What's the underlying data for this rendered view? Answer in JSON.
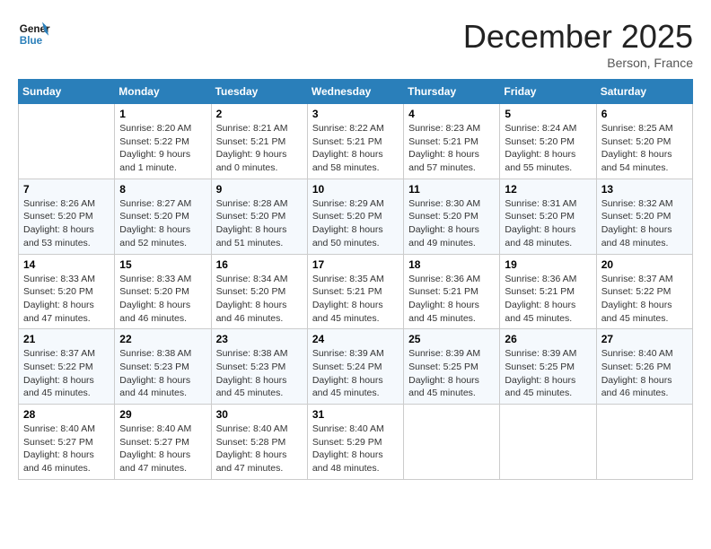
{
  "header": {
    "logo_line1": "General",
    "logo_line2": "Blue",
    "month_title": "December 2025",
    "location": "Berson, France"
  },
  "weekdays": [
    "Sunday",
    "Monday",
    "Tuesday",
    "Wednesday",
    "Thursday",
    "Friday",
    "Saturday"
  ],
  "weeks": [
    [
      {
        "day": "",
        "info": ""
      },
      {
        "day": "1",
        "info": "Sunrise: 8:20 AM\nSunset: 5:22 PM\nDaylight: 9 hours\nand 1 minute."
      },
      {
        "day": "2",
        "info": "Sunrise: 8:21 AM\nSunset: 5:21 PM\nDaylight: 9 hours\nand 0 minutes."
      },
      {
        "day": "3",
        "info": "Sunrise: 8:22 AM\nSunset: 5:21 PM\nDaylight: 8 hours\nand 58 minutes."
      },
      {
        "day": "4",
        "info": "Sunrise: 8:23 AM\nSunset: 5:21 PM\nDaylight: 8 hours\nand 57 minutes."
      },
      {
        "day": "5",
        "info": "Sunrise: 8:24 AM\nSunset: 5:20 PM\nDaylight: 8 hours\nand 55 minutes."
      },
      {
        "day": "6",
        "info": "Sunrise: 8:25 AM\nSunset: 5:20 PM\nDaylight: 8 hours\nand 54 minutes."
      }
    ],
    [
      {
        "day": "7",
        "info": "Sunrise: 8:26 AM\nSunset: 5:20 PM\nDaylight: 8 hours\nand 53 minutes."
      },
      {
        "day": "8",
        "info": "Sunrise: 8:27 AM\nSunset: 5:20 PM\nDaylight: 8 hours\nand 52 minutes."
      },
      {
        "day": "9",
        "info": "Sunrise: 8:28 AM\nSunset: 5:20 PM\nDaylight: 8 hours\nand 51 minutes."
      },
      {
        "day": "10",
        "info": "Sunrise: 8:29 AM\nSunset: 5:20 PM\nDaylight: 8 hours\nand 50 minutes."
      },
      {
        "day": "11",
        "info": "Sunrise: 8:30 AM\nSunset: 5:20 PM\nDaylight: 8 hours\nand 49 minutes."
      },
      {
        "day": "12",
        "info": "Sunrise: 8:31 AM\nSunset: 5:20 PM\nDaylight: 8 hours\nand 48 minutes."
      },
      {
        "day": "13",
        "info": "Sunrise: 8:32 AM\nSunset: 5:20 PM\nDaylight: 8 hours\nand 48 minutes."
      }
    ],
    [
      {
        "day": "14",
        "info": "Sunrise: 8:33 AM\nSunset: 5:20 PM\nDaylight: 8 hours\nand 47 minutes."
      },
      {
        "day": "15",
        "info": "Sunrise: 8:33 AM\nSunset: 5:20 PM\nDaylight: 8 hours\nand 46 minutes."
      },
      {
        "day": "16",
        "info": "Sunrise: 8:34 AM\nSunset: 5:20 PM\nDaylight: 8 hours\nand 46 minutes."
      },
      {
        "day": "17",
        "info": "Sunrise: 8:35 AM\nSunset: 5:21 PM\nDaylight: 8 hours\nand 45 minutes."
      },
      {
        "day": "18",
        "info": "Sunrise: 8:36 AM\nSunset: 5:21 PM\nDaylight: 8 hours\nand 45 minutes."
      },
      {
        "day": "19",
        "info": "Sunrise: 8:36 AM\nSunset: 5:21 PM\nDaylight: 8 hours\nand 45 minutes."
      },
      {
        "day": "20",
        "info": "Sunrise: 8:37 AM\nSunset: 5:22 PM\nDaylight: 8 hours\nand 45 minutes."
      }
    ],
    [
      {
        "day": "21",
        "info": "Sunrise: 8:37 AM\nSunset: 5:22 PM\nDaylight: 8 hours\nand 45 minutes."
      },
      {
        "day": "22",
        "info": "Sunrise: 8:38 AM\nSunset: 5:23 PM\nDaylight: 8 hours\nand 44 minutes."
      },
      {
        "day": "23",
        "info": "Sunrise: 8:38 AM\nSunset: 5:23 PM\nDaylight: 8 hours\nand 45 minutes."
      },
      {
        "day": "24",
        "info": "Sunrise: 8:39 AM\nSunset: 5:24 PM\nDaylight: 8 hours\nand 45 minutes."
      },
      {
        "day": "25",
        "info": "Sunrise: 8:39 AM\nSunset: 5:25 PM\nDaylight: 8 hours\nand 45 minutes."
      },
      {
        "day": "26",
        "info": "Sunrise: 8:39 AM\nSunset: 5:25 PM\nDaylight: 8 hours\nand 45 minutes."
      },
      {
        "day": "27",
        "info": "Sunrise: 8:40 AM\nSunset: 5:26 PM\nDaylight: 8 hours\nand 46 minutes."
      }
    ],
    [
      {
        "day": "28",
        "info": "Sunrise: 8:40 AM\nSunset: 5:27 PM\nDaylight: 8 hours\nand 46 minutes."
      },
      {
        "day": "29",
        "info": "Sunrise: 8:40 AM\nSunset: 5:27 PM\nDaylight: 8 hours\nand 47 minutes."
      },
      {
        "day": "30",
        "info": "Sunrise: 8:40 AM\nSunset: 5:28 PM\nDaylight: 8 hours\nand 47 minutes."
      },
      {
        "day": "31",
        "info": "Sunrise: 8:40 AM\nSunset: 5:29 PM\nDaylight: 8 hours\nand 48 minutes."
      },
      {
        "day": "",
        "info": ""
      },
      {
        "day": "",
        "info": ""
      },
      {
        "day": "",
        "info": ""
      }
    ]
  ]
}
